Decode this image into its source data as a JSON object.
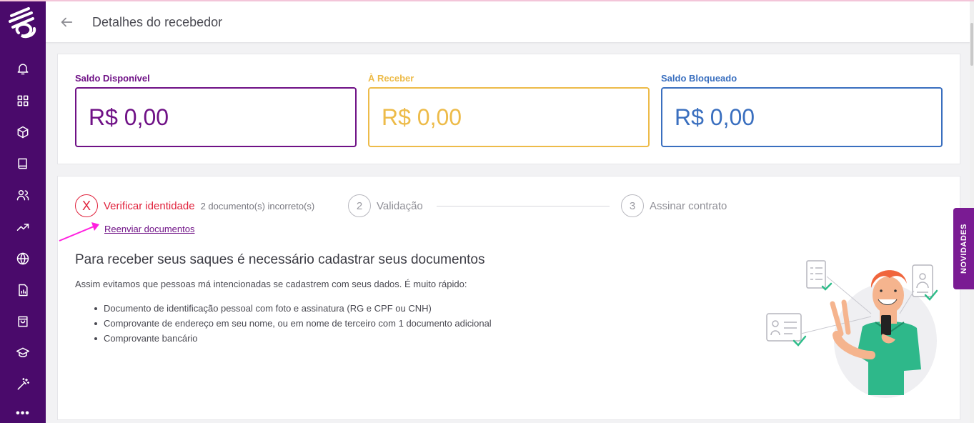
{
  "header": {
    "title": "Detalhes do recebedor"
  },
  "sidebar": {
    "items": [
      {
        "icon": "bell-icon"
      },
      {
        "icon": "grid-icon"
      },
      {
        "icon": "box-icon"
      },
      {
        "icon": "book-icon"
      },
      {
        "icon": "users-icon"
      },
      {
        "icon": "trending-up-icon"
      },
      {
        "icon": "globe-icon"
      },
      {
        "icon": "report-icon"
      },
      {
        "icon": "shopping-bag-icon"
      },
      {
        "icon": "graduation-cap-icon"
      },
      {
        "icon": "magic-wand-icon"
      }
    ],
    "more": "•••"
  },
  "balances": {
    "available": {
      "label": "Saldo Disponível",
      "value": "R$ 0,00",
      "color": "#6f1186"
    },
    "receivable": {
      "label": "À Receber",
      "value": "R$ 0,00",
      "color": "#edbb49"
    },
    "blocked": {
      "label": "Saldo Bloqueado",
      "value": "R$ 0,00",
      "color": "#3a6fbf"
    }
  },
  "steps": [
    {
      "marker": "X",
      "name": "Verificar identidade",
      "sub": "2 documento(s) incorreto(s)",
      "status": "error"
    },
    {
      "marker": "2",
      "name": "Validação"
    },
    {
      "marker": "3",
      "name": "Assinar contrato"
    }
  ],
  "resend_link": "Reenviar documentos",
  "content": {
    "heading": "Para receber seus saques é necessário cadastrar seus documentos",
    "description": "Assim evitamos que pessoas má intencionadas se cadastrem com seus dados. É muito rápido:",
    "items": [
      "Documento de identificação pessoal com foto e assinatura (RG e CPF ou CNH)",
      "Comprovante de endereço em seu nome, ou em nome de terceiro com 1 documento adicional",
      "Comprovante bancário"
    ]
  },
  "novidades": "NOVIDADES",
  "colors": {
    "sidebar": "#4a0a6b",
    "error": "#e0223c",
    "accent": "#6f1186"
  }
}
